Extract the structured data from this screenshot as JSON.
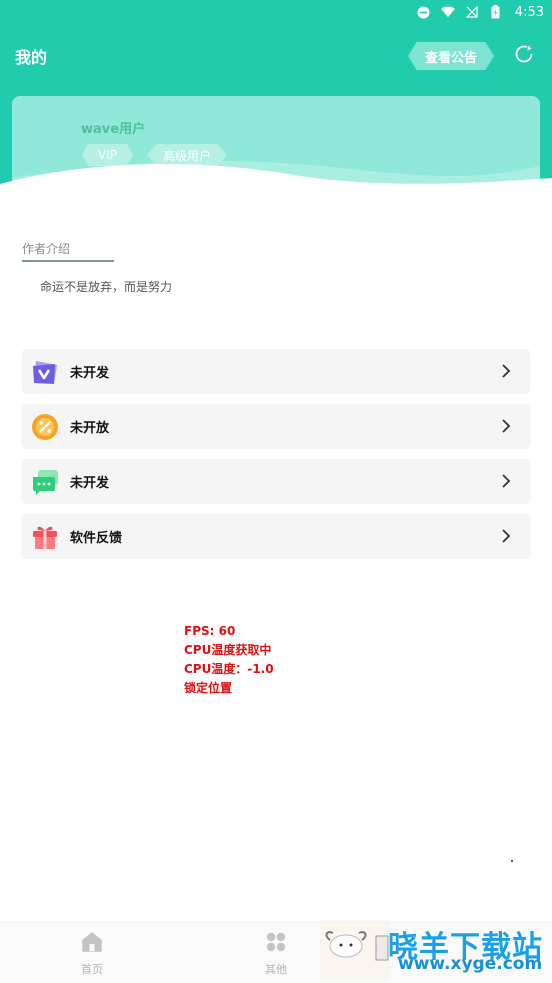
{
  "status_bar": {
    "time": "4:53",
    "icons": [
      "dnd-icon",
      "wifi-icon",
      "no-signal-icon",
      "battery-icon"
    ]
  },
  "header": {
    "title": "我的",
    "notice_button_label": "查看公告",
    "refresh_icon": "refresh-icon",
    "bg_color": "#21cbad"
  },
  "profile": {
    "username": "wave用户",
    "badges": [
      "VIP",
      "高级用户"
    ]
  },
  "author": {
    "label": "作者介绍",
    "motto": "命运不是放弃，而是努力"
  },
  "menu": {
    "items": [
      {
        "label": "未开发",
        "icon": "v-badge-icon",
        "color": "#6c5ce7"
      },
      {
        "label": "未开放",
        "icon": "percent-coin-icon",
        "color": "#f7a325"
      },
      {
        "label": "未开发",
        "icon": "chat-bubble-icon",
        "color": "#2fcf7a"
      },
      {
        "label": "软件反馈",
        "icon": "gift-icon",
        "color": "#f2505a"
      }
    ]
  },
  "debug": {
    "fps": "FPS: 60",
    "cpu_status": "CPU温度获取中",
    "cpu_temp": "CPU温度：-1.0",
    "lock": "锁定位置"
  },
  "bottom_nav": {
    "items": [
      {
        "label": "首页",
        "icon": "home-icon"
      },
      {
        "label": "其他",
        "icon": "grid-icon"
      }
    ]
  },
  "watermark": {
    "text": "晓羊下载站",
    "url": "www.xyge.com"
  }
}
